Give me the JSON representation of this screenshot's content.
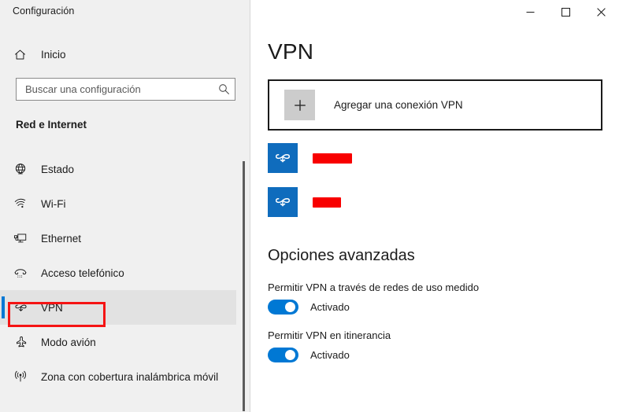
{
  "window": {
    "title": "Configuración",
    "controls": [
      {
        "name": "minimize",
        "label": "Minimizar"
      },
      {
        "name": "maximize",
        "label": "Maximizar"
      },
      {
        "name": "close",
        "label": "Cerrar"
      }
    ]
  },
  "sidebar": {
    "home": {
      "label": "Inicio",
      "icon": "home-icon"
    },
    "search": {
      "value": "",
      "placeholder": "Buscar una configuración",
      "icon": "search-icon"
    },
    "section_heading": "Red e Internet",
    "items": [
      {
        "label": "Estado",
        "icon": "globe-icon",
        "selected": false
      },
      {
        "label": "Wi-Fi",
        "icon": "wifi-icon",
        "selected": false
      },
      {
        "label": "Ethernet",
        "icon": "ethernet-icon",
        "selected": false
      },
      {
        "label": "Acceso telefónico",
        "icon": "dialup-phone-icon",
        "selected": false
      },
      {
        "label": "VPN",
        "icon": "vpn-icon",
        "selected": true
      },
      {
        "label": "Modo avión",
        "icon": "airplane-icon",
        "selected": false
      },
      {
        "label": "Zona con cobertura inalámbrica móvil",
        "icon": "hotspot-icon",
        "selected": false
      }
    ],
    "annotation_color": "#f51414",
    "accent_color": "#0078d4"
  },
  "main": {
    "page_title": "VPN",
    "add_connection": {
      "label": "Agregar una conexión VPN",
      "icon": "plus-icon"
    },
    "connections": [
      {
        "name_redacted": true,
        "redaction_width": 50,
        "icon": "vpn-connection-icon"
      },
      {
        "name_redacted": true,
        "redaction_width": 36,
        "icon": "vpn-connection-icon"
      }
    ],
    "advanced": {
      "heading": "Opciones avanzadas",
      "settings": [
        {
          "label": "Permitir VPN a través de redes de uso medido",
          "state": "Activado",
          "on": true
        },
        {
          "label": "Permitir VPN en itinerancia",
          "state": "Activado",
          "on": true
        }
      ]
    }
  },
  "colors": {
    "accent": "#0078d4",
    "vpn_tile": "#0f6cbd",
    "redaction": "#f80000",
    "annotation": "#f51414",
    "sidebar_bg": "#f0f0f0",
    "content_bg": "#ffffff"
  }
}
